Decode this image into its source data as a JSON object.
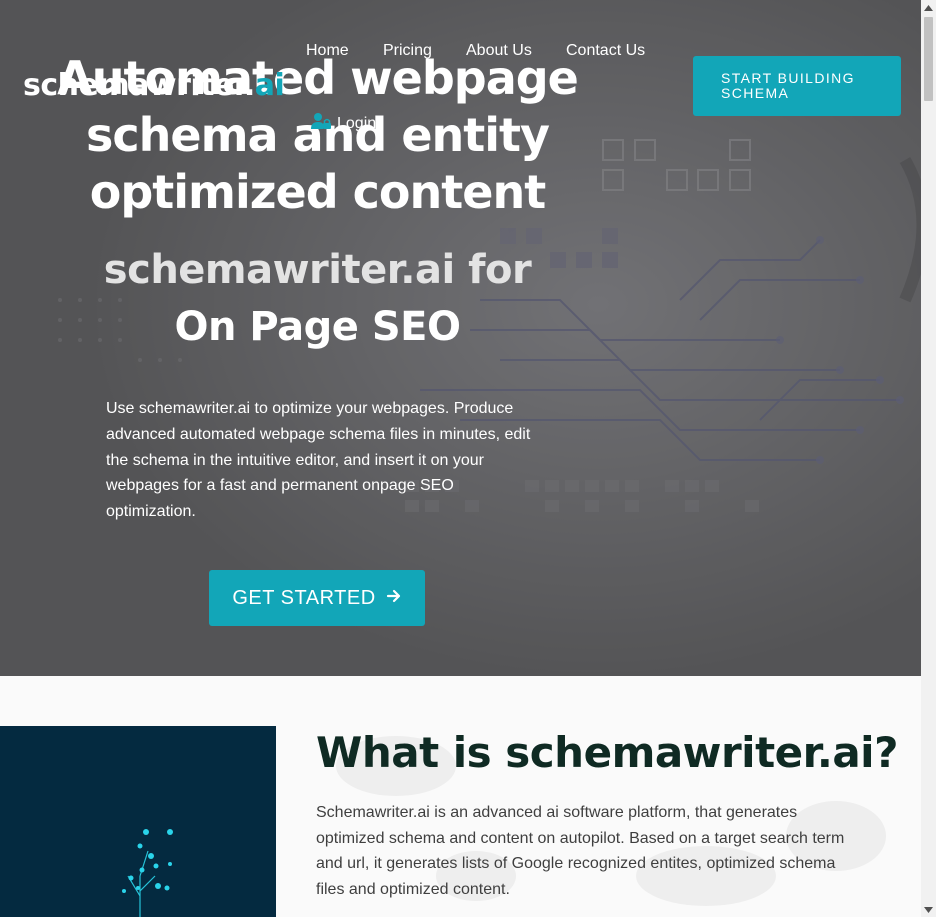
{
  "brand": {
    "logo_main": "schemawriter.",
    "logo_accent": "ai",
    "accent_color": "#12a6b8"
  },
  "nav": {
    "items": [
      {
        "label": "Home"
      },
      {
        "label": "Pricing"
      },
      {
        "label": "About Us"
      },
      {
        "label": "Contact Us"
      }
    ],
    "login_label": "Login",
    "login_icon": "user-lock-icon"
  },
  "header_cta": {
    "label": "START BUILDING SCHEMA"
  },
  "hero": {
    "headline": "Automated webpage schema and entity optimized content",
    "subhead_line1": "schemawriter.ai for",
    "subhead_line2": "On Page SEO",
    "description": "Use schemawriter.ai to optimize your webpages. Produce advanced automated webpage schema files in minutes, edit the schema in the intuitive editor, and insert it on your webpages for a fast and permanent onpage SEO optimization.",
    "cta_label": "GET STARTED",
    "cta_icon": "arrow-right-icon"
  },
  "about": {
    "title": "What is schemawriter.ai?",
    "description": "Schemawriter.ai is an advanced ai software platform, that generates optimized schema and content on autopilot. Based on a target search term and url, it generates lists of Google recognized entites, optimized schema files and optimized content."
  }
}
